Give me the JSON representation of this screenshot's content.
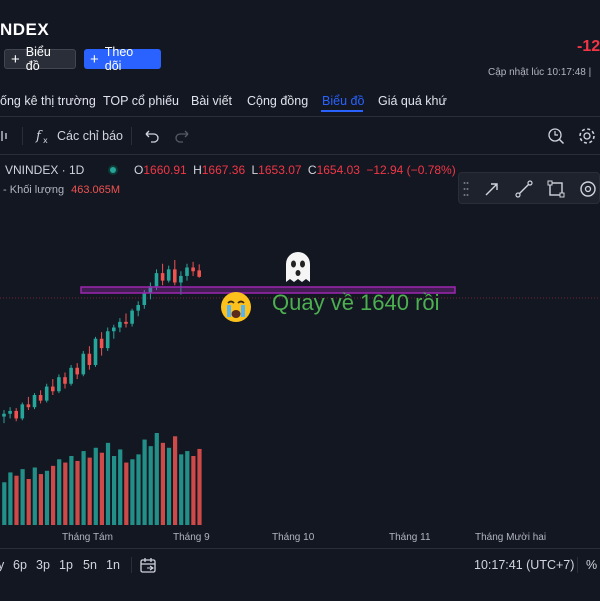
{
  "header": {
    "title": "NDEX",
    "chart_button": "Biểu đồ",
    "follow_button": "Theo dõi",
    "change_truncated": "-12",
    "updated_label": "Cập nhật lúc  10:17:48 | "
  },
  "nav": {
    "items": [
      "ống kê thị trường",
      "TOP cổ phiếu",
      "Bài viết",
      "Cộng đồng",
      "Biểu đồ",
      "Giá quá khứ"
    ],
    "active_index": 4
  },
  "toolbar": {
    "indicators_label": "Các chỉ báo"
  },
  "legend": {
    "symbol": "VNINDEX · 1D",
    "open_label": "O",
    "open": "1660.91",
    "high_label": "H",
    "high": "1667.36",
    "low_label": "L",
    "low": "1653.07",
    "close_label": "C",
    "close": "1654.03",
    "change": "−12.94 (−0.78%)",
    "volume_label": "Khối lượng",
    "volume": "463.065M"
  },
  "annotation": {
    "text": "Quay về 1640 rồi"
  },
  "timeaxis": {
    "labels": [
      "Tháng Tám",
      "Tháng 9",
      "Tháng 10",
      "Tháng 11",
      "Tháng Mười hai"
    ]
  },
  "bottom": {
    "ranges": [
      "y",
      "6p",
      "3p",
      "1p",
      "5n",
      "1n"
    ],
    "clock": "10:17:41 (UTC+7)",
    "percent": "%"
  },
  "colors": {
    "up": "#26a69a",
    "down": "#ef5350",
    "accent": "#2962ff",
    "annotation_line": "#9c27b0",
    "annotation_text": "#4caf50"
  },
  "icons": [
    "plus-icon",
    "undo-icon",
    "redo-icon",
    "function-icon",
    "search-settings-icon",
    "gear-icon",
    "arrow-icon",
    "line-icon",
    "rectangle-icon",
    "eye-icon",
    "calendar-icon",
    "ghost-icon",
    "crying-face-icon"
  ],
  "chart_data": {
    "type": "candlestick",
    "series": [
      {
        "name": "VNINDEX",
        "candles": [
          [
            1505,
            1512,
            1498,
            1508
          ],
          [
            1508,
            1515,
            1503,
            1511
          ],
          [
            1511,
            1514,
            1500,
            1503
          ],
          [
            1503,
            1520,
            1501,
            1518
          ],
          [
            1518,
            1526,
            1512,
            1515
          ],
          [
            1515,
            1530,
            1513,
            1528
          ],
          [
            1528,
            1533,
            1519,
            1522
          ],
          [
            1522,
            1540,
            1520,
            1537
          ],
          [
            1537,
            1545,
            1528,
            1532
          ],
          [
            1532,
            1550,
            1530,
            1547
          ],
          [
            1547,
            1552,
            1535,
            1540
          ],
          [
            1540,
            1560,
            1538,
            1557
          ],
          [
            1557,
            1562,
            1545,
            1550
          ],
          [
            1550,
            1575,
            1548,
            1572
          ],
          [
            1572,
            1580,
            1555,
            1560
          ],
          [
            1560,
            1590,
            1558,
            1588
          ],
          [
            1588,
            1595,
            1570,
            1578
          ],
          [
            1578,
            1600,
            1575,
            1596
          ],
          [
            1596,
            1603,
            1588,
            1600
          ],
          [
            1600,
            1610,
            1595,
            1606
          ],
          [
            1606,
            1615,
            1600,
            1604
          ],
          [
            1604,
            1620,
            1601,
            1618
          ],
          [
            1618,
            1628,
            1612,
            1624
          ],
          [
            1624,
            1640,
            1620,
            1637
          ],
          [
            1637,
            1648,
            1630,
            1644
          ],
          [
            1644,
            1662,
            1640,
            1658
          ],
          [
            1658,
            1668,
            1645,
            1650
          ],
          [
            1650,
            1666,
            1648,
            1662
          ],
          [
            1662,
            1672,
            1645,
            1648
          ],
          [
            1648,
            1660,
            1635,
            1655
          ],
          [
            1655,
            1668,
            1650,
            1664
          ],
          [
            1664,
            1670,
            1655,
            1660
          ],
          [
            1660.91,
            1667.36,
            1653.07,
            1654.03
          ]
        ],
        "volumes": [
          260,
          320,
          300,
          340,
          280,
          350,
          310,
          330,
          360,
          400,
          380,
          420,
          390,
          450,
          410,
          470,
          440,
          500,
          420,
          460,
          380,
          400,
          430,
          520,
          480,
          560,
          500,
          470,
          540,
          430,
          450,
          420,
          463
        ]
      }
    ],
    "annotation_level": 1640,
    "ylim": [
      1480,
      1720
    ]
  }
}
